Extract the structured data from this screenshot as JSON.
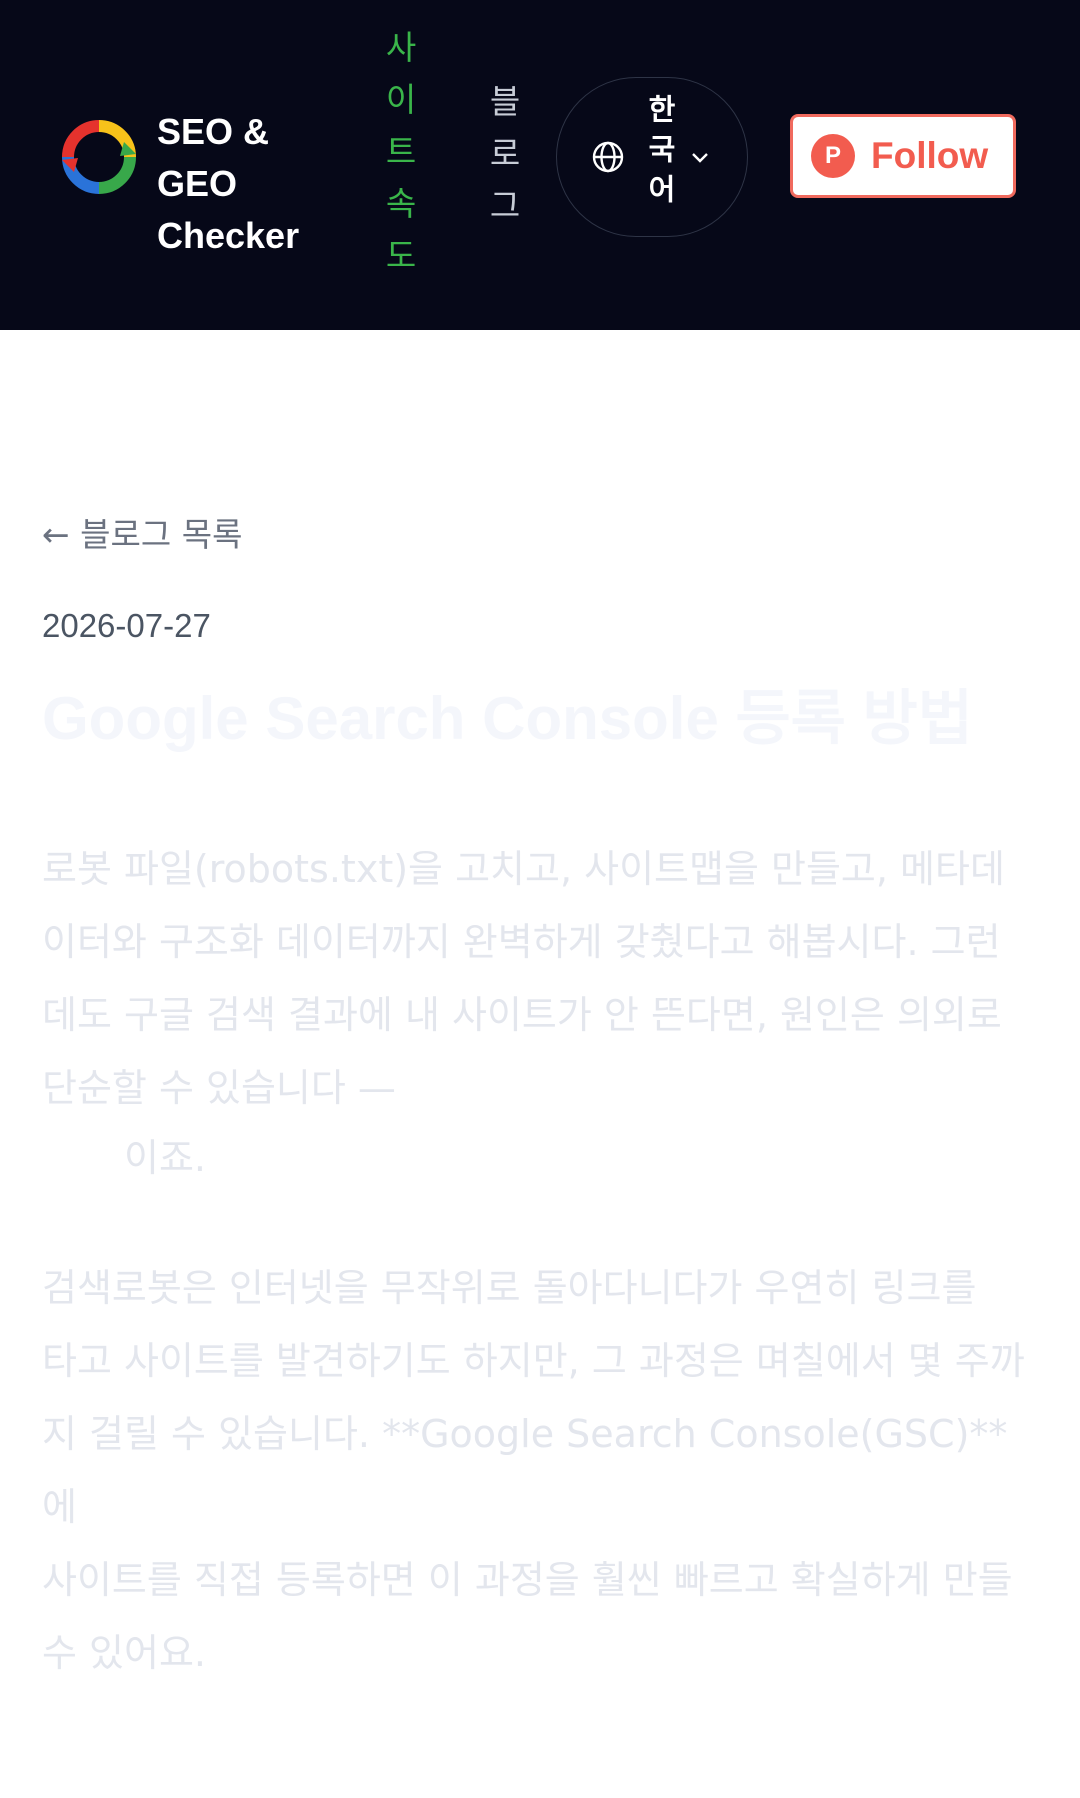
{
  "header": {
    "brand_line1": "SEO & GEO",
    "brand_line2": "Checker",
    "nav_speed": "사이트속도",
    "nav_blog": "블로그",
    "language": "한국어",
    "follow_label": "Follow",
    "follow_icon_letter": "P",
    "colors": {
      "background": "#060818",
      "nav_active": "#3ab54a",
      "follow_accent": "#f25c4f"
    }
  },
  "article": {
    "back_link": "← 블로그 목록",
    "date": "2026-07-27",
    "title": "Google Search Console 등록 방법",
    "paragraph1": "로봇 파일(robots.txt)을 고치고, 사이트맵을 만들고, 메타데\n이터와 구조화 데이터까지 완벽하게 갖췄다고 해봅시다. 그런\n데도 구글 검색 결과에 내 사이트가 안 뜬다면, 원인은 의외로\n단순할 수 있습니다 —",
    "paragraph1_tail": "이죠.",
    "paragraph2": "검색로봇은 인터넷을 무작위로 돌아다니다가 우연히 링크를\n타고 사이트를 발견하기도 하지만, 그 과정은 며칠에서 몇 주까\n지 걸릴 수 있습니다. **Google Search Console(GSC)**에\n사이트를 직접 등록하면 이 과정을 훨씬 빠르고 확실하게 만들\n수 있어요."
  }
}
